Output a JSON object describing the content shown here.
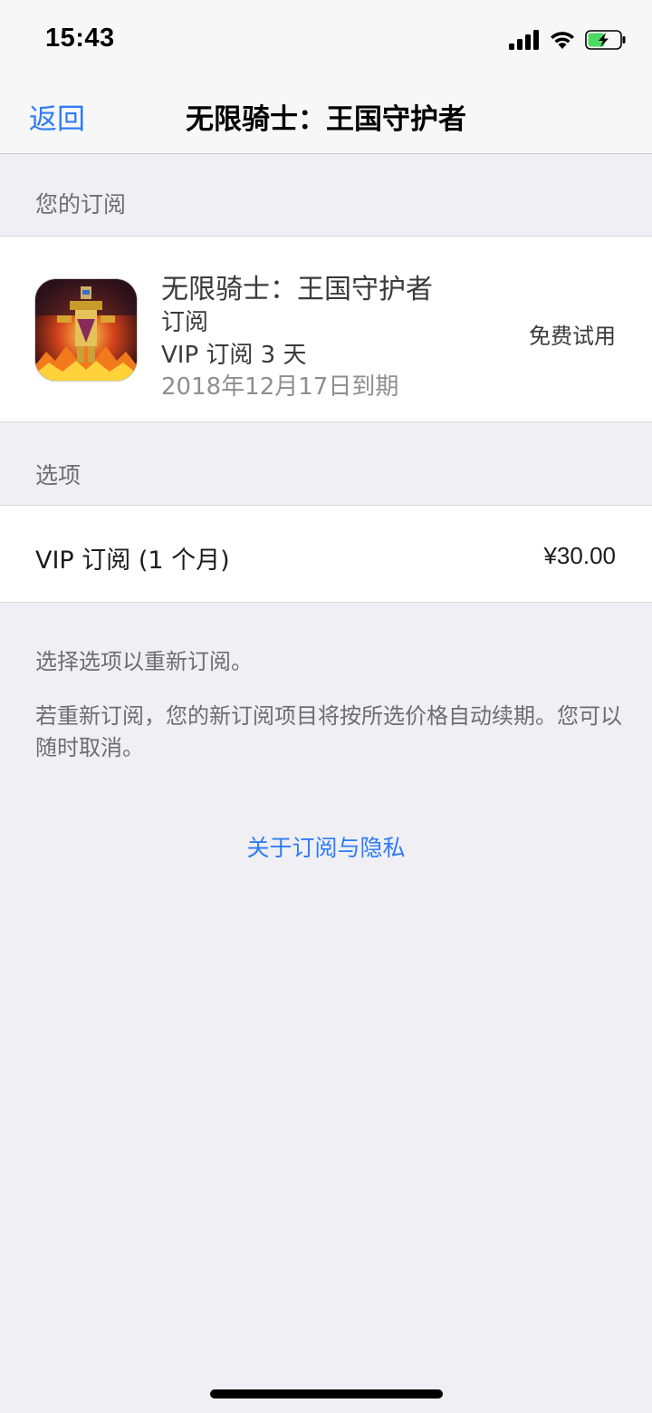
{
  "status_bar": {
    "time": "15:43",
    "icons": [
      "signal-icon",
      "wifi-icon",
      "battery-charging-icon"
    ]
  },
  "nav": {
    "back_label": "返回",
    "title": "无限骑士：王国守护者"
  },
  "subscription_section": {
    "header": "您的订阅",
    "item": {
      "app_name": "无限骑士：王国守护者",
      "type": "订阅",
      "plan": "VIP 订阅 3 天",
      "expiry": "2018年12月17日到期",
      "status": "免费试用",
      "icon": "app-icon-knight"
    }
  },
  "options_section": {
    "header": "选项",
    "options": [
      {
        "label": "VIP 订阅 (1 个月)",
        "price": "¥30.00"
      }
    ]
  },
  "notes": {
    "line1": "选择选项以重新订阅。",
    "line2": "若重新订阅，您的新订阅项目将按所选价格自动续期。您可以随时取消。"
  },
  "footer": {
    "privacy_link": "关于订阅与隐私"
  },
  "colors": {
    "accent": "#2f7cf6",
    "background": "#efeff4",
    "secondary_text": "#6d6d72"
  }
}
